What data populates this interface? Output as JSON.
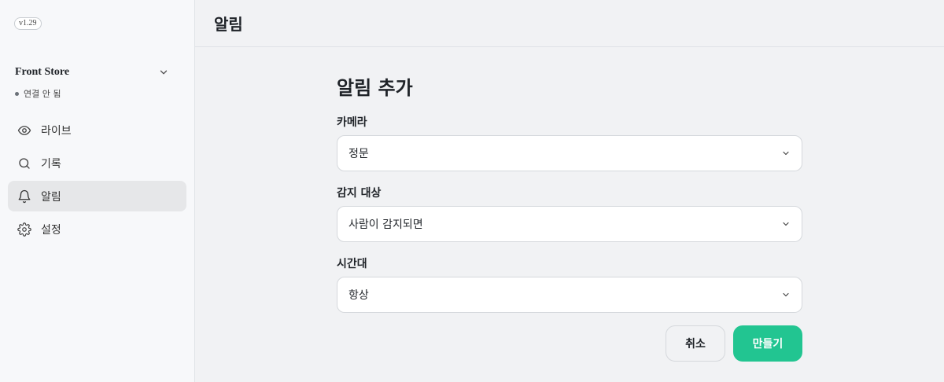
{
  "sidebar": {
    "version": "v1.29",
    "store_name": "Front Store",
    "status": "연결 안 됨",
    "items": [
      {
        "label": "라이브",
        "icon": "eye-icon"
      },
      {
        "label": "기록",
        "icon": "search-icon"
      },
      {
        "label": "알림",
        "icon": "bell-icon",
        "active": true
      },
      {
        "label": "설정",
        "icon": "gear-icon"
      }
    ]
  },
  "header": {
    "title": "알림"
  },
  "form": {
    "title": "알림 추가",
    "camera_label": "카메라",
    "camera_value": "정문",
    "detect_label": "감지 대상",
    "detect_value": "사람이 감지되면",
    "time_label": "시간대",
    "time_value": "항상",
    "cancel_label": "취소",
    "create_label": "만들기"
  },
  "colors": {
    "accent": "#22c591",
    "active_nav_bg": "#e6e7e9",
    "status_dot": "#6b7178"
  }
}
